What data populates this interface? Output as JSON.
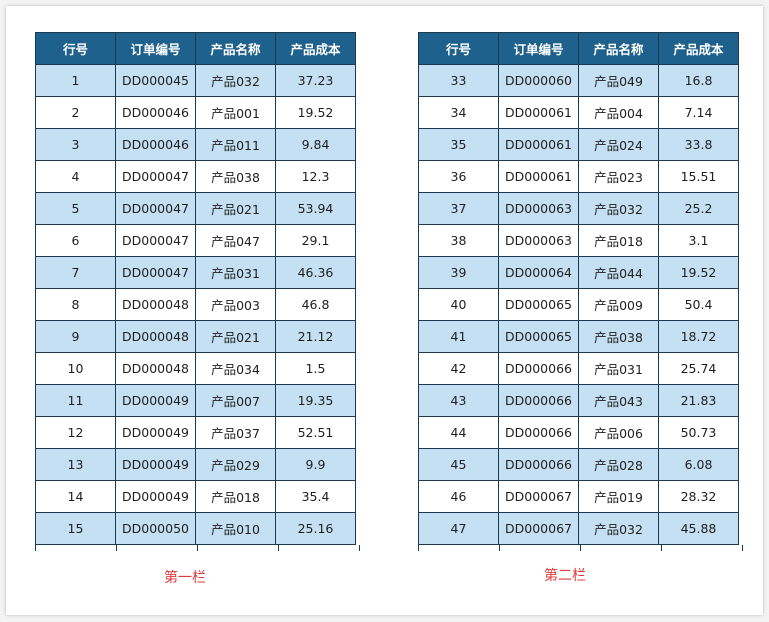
{
  "headers": [
    "行号",
    "订单编号",
    "产品名称",
    "产品成本"
  ],
  "columns": [
    {
      "caption": "第一栏",
      "rows": [
        [
          "1",
          "DD000045",
          "产品032",
          "37.23"
        ],
        [
          "2",
          "DD000046",
          "产品001",
          "19.52"
        ],
        [
          "3",
          "DD000046",
          "产品011",
          "9.84"
        ],
        [
          "4",
          "DD000047",
          "产品038",
          "12.3"
        ],
        [
          "5",
          "DD000047",
          "产品021",
          "53.94"
        ],
        [
          "6",
          "DD000047",
          "产品047",
          "29.1"
        ],
        [
          "7",
          "DD000047",
          "产品031",
          "46.36"
        ],
        [
          "8",
          "DD000048",
          "产品003",
          "46.8"
        ],
        [
          "9",
          "DD000048",
          "产品021",
          "21.12"
        ],
        [
          "10",
          "DD000048",
          "产品034",
          "1.5"
        ],
        [
          "11",
          "DD000049",
          "产品007",
          "19.35"
        ],
        [
          "12",
          "DD000049",
          "产品037",
          "52.51"
        ],
        [
          "13",
          "DD000049",
          "产品029",
          "9.9"
        ],
        [
          "14",
          "DD000049",
          "产品018",
          "35.4"
        ],
        [
          "15",
          "DD000050",
          "产品010",
          "25.16"
        ]
      ]
    },
    {
      "caption": "第二栏",
      "rows": [
        [
          "33",
          "DD000060",
          "产品049",
          "16.8"
        ],
        [
          "34",
          "DD000061",
          "产品004",
          "7.14"
        ],
        [
          "35",
          "DD000061",
          "产品024",
          "33.8"
        ],
        [
          "36",
          "DD000061",
          "产品023",
          "15.51"
        ],
        [
          "37",
          "DD000063",
          "产品032",
          "25.2"
        ],
        [
          "38",
          "DD000063",
          "产品018",
          "3.1"
        ],
        [
          "39",
          "DD000064",
          "产品044",
          "19.52"
        ],
        [
          "40",
          "DD000065",
          "产品009",
          "50.4"
        ],
        [
          "41",
          "DD000065",
          "产品038",
          "18.72"
        ],
        [
          "42",
          "DD000066",
          "产品031",
          "25.74"
        ],
        [
          "43",
          "DD000066",
          "产品043",
          "21.83"
        ],
        [
          "44",
          "DD000066",
          "产品006",
          "50.73"
        ],
        [
          "45",
          "DD000066",
          "产品028",
          "6.08"
        ],
        [
          "46",
          "DD000067",
          "产品019",
          "28.32"
        ],
        [
          "47",
          "DD000067",
          "产品032",
          "45.88"
        ]
      ]
    }
  ],
  "colors": {
    "header_bg": "#1f618d",
    "stripe_bg": "#c5e0f2",
    "caption": "#e03a3a"
  }
}
